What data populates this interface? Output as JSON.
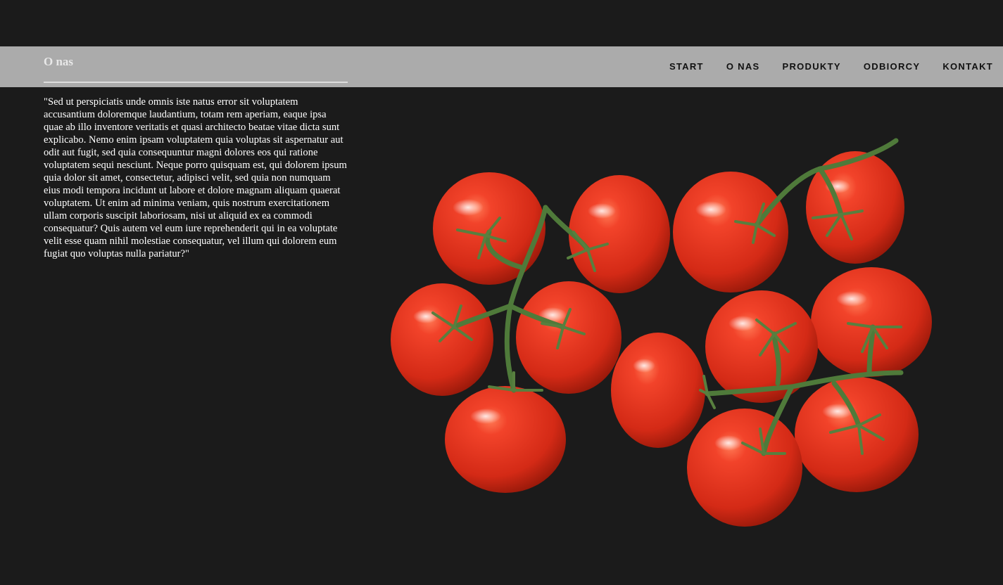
{
  "page": {
    "title": "O nas"
  },
  "nav": {
    "items": [
      {
        "label": "START"
      },
      {
        "label": "O NAS"
      },
      {
        "label": "PRODUKTY"
      },
      {
        "label": "ODBIORCY"
      },
      {
        "label": "KONTAKT"
      }
    ]
  },
  "content": {
    "text": "\"Sed ut perspiciatis unde omnis iste natus error sit voluptatem accusantium doloremque laudantium, totam rem aperiam, eaque ipsa quae ab illo inventore veritatis et quasi architecto beatae vitae dicta sunt explicabo. Nemo enim ipsam voluptatem quia voluptas sit aspernatur aut odit aut fugit, sed quia consequuntur magni dolores eos qui ratione voluptatem sequi nesciunt. Neque porro quisquam est, qui dolorem ipsum quia dolor sit amet, consectetur, adipisci velit, sed quia non numquam eius modi tempora incidunt ut labore et dolore magnam aliquam quaerat voluptatem. Ut enim ad minima veniam, quis nostrum exercitationem ullam corporis suscipit laboriosam, nisi ut aliquid ex ea commodi consequatur? Quis autem vel eum iure reprehenderit qui in ea voluptate velit esse quam nihil molestiae consequatur, vel illum qui dolorem eum fugiat quo voluptas nulla pariatur?\""
  },
  "colors": {
    "background": "#1b1b1b",
    "header": "#ababab",
    "tomato": "#e0301e",
    "stem": "#4f7a3a"
  }
}
